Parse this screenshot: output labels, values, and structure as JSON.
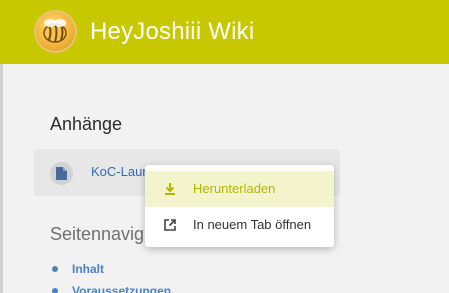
{
  "header": {
    "title": "HeyJoshiii Wiki",
    "logo_icon": "bee-logo"
  },
  "attachments": {
    "heading": "Anhänge",
    "items": [
      {
        "name": "KoC-Laur",
        "icon": "file-icon"
      }
    ]
  },
  "context_menu": {
    "items": [
      {
        "label": "Herunterladen",
        "icon": "download-icon"
      },
      {
        "label": "In neuem Tab öffnen",
        "icon": "open-external-icon"
      }
    ]
  },
  "page_nav": {
    "heading": "Seitennavig",
    "items": [
      {
        "label": "Inhalt"
      },
      {
        "label": "Voraussetzungen"
      }
    ]
  },
  "colors": {
    "header_bg": "#c8c800",
    "link": "#2f6eb5",
    "menu_highlight_bg": "#f4f4cc",
    "menu_highlight_text": "#b5b500"
  }
}
